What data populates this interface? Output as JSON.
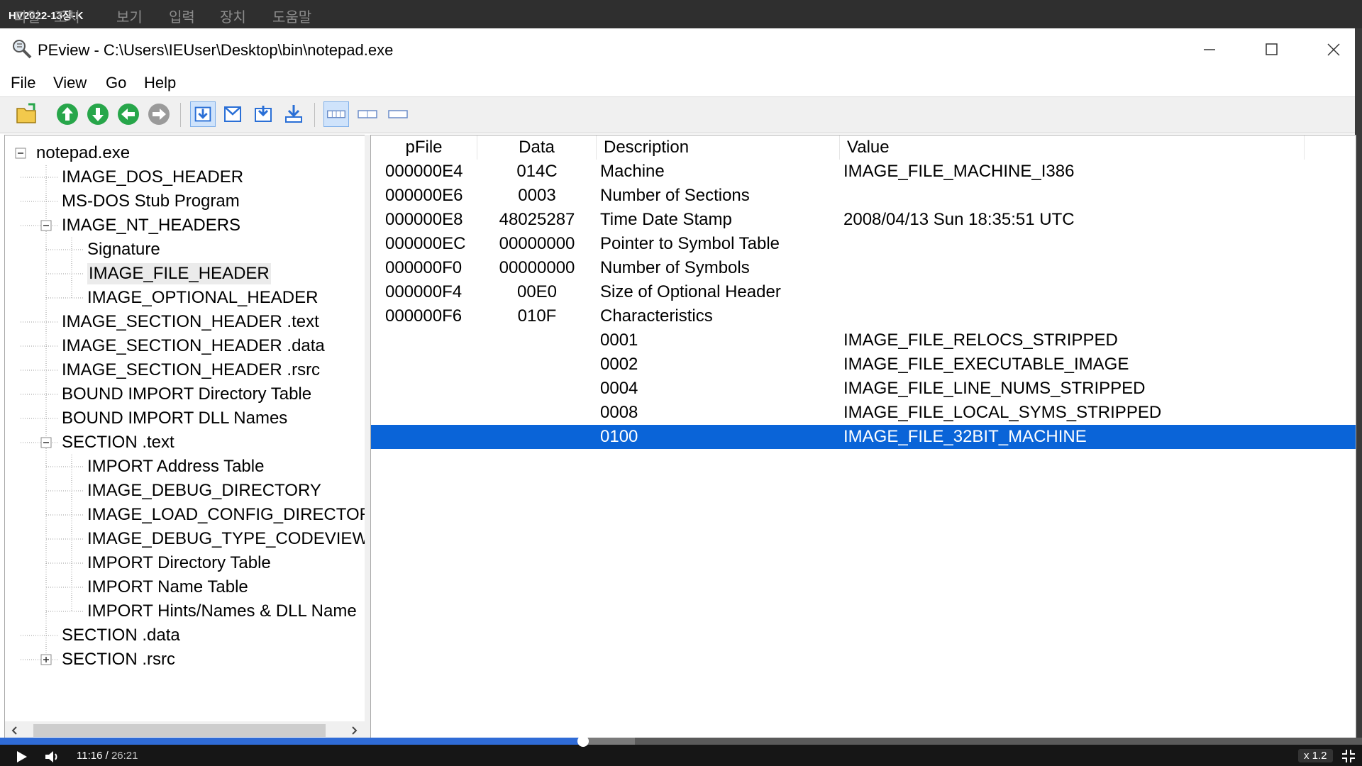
{
  "vm_window": {
    "title": "HV2022-13장-K",
    "menu": [
      "파일",
      "조치",
      "보기",
      "입력",
      "장치",
      "도움말"
    ]
  },
  "app": {
    "title": "PEview - C:\\Users\\IEUser\\Desktop\\bin\\notepad.exe",
    "icon": "magnifier-app-icon"
  },
  "window_controls": [
    "minimize-icon",
    "maximize-icon",
    "close-icon"
  ],
  "menubar": [
    "File",
    "View",
    "Go",
    "Help"
  ],
  "toolbar_icons": [
    "open-file-icon",
    "up-arrow-icon",
    "down-arrow-icon",
    "back-arrow-icon",
    "forward-arrow-icon",
    "view-byte-icon",
    "view-word-icon",
    "view-dword-icon",
    "view-address-icon",
    "view-hex-icon",
    "view-ansi-icon",
    "view-unicode-icon"
  ],
  "tree": {
    "items": [
      {
        "label": "notepad.exe",
        "level": 0,
        "expander": "minus"
      },
      {
        "label": "IMAGE_DOS_HEADER",
        "level": 1
      },
      {
        "label": "MS-DOS Stub Program",
        "level": 1
      },
      {
        "label": "IMAGE_NT_HEADERS",
        "level": 1,
        "expander": "minus"
      },
      {
        "label": "Signature",
        "level": 2
      },
      {
        "label": "IMAGE_FILE_HEADER",
        "level": 2,
        "selected": true
      },
      {
        "label": "IMAGE_OPTIONAL_HEADER",
        "level": 2
      },
      {
        "label": "IMAGE_SECTION_HEADER .text",
        "level": 1
      },
      {
        "label": "IMAGE_SECTION_HEADER .data",
        "level": 1
      },
      {
        "label": "IMAGE_SECTION_HEADER .rsrc",
        "level": 1
      },
      {
        "label": "BOUND IMPORT Directory Table",
        "level": 1
      },
      {
        "label": "BOUND IMPORT DLL Names",
        "level": 1
      },
      {
        "label": "SECTION .text",
        "level": 1,
        "expander": "minus"
      },
      {
        "label": "IMPORT Address Table",
        "level": 2
      },
      {
        "label": "IMAGE_DEBUG_DIRECTORY",
        "level": 2
      },
      {
        "label": "IMAGE_LOAD_CONFIG_DIRECTOR",
        "level": 2
      },
      {
        "label": "IMAGE_DEBUG_TYPE_CODEVIEW",
        "level": 2
      },
      {
        "label": "IMPORT Directory Table",
        "level": 2
      },
      {
        "label": "IMPORT Name Table",
        "level": 2
      },
      {
        "label": "IMPORT Hints/Names & DLL Name",
        "level": 2
      },
      {
        "label": "SECTION .data",
        "level": 1
      },
      {
        "label": "SECTION .rsrc",
        "level": 1,
        "expander": "plus"
      }
    ]
  },
  "table": {
    "columns": [
      "pFile",
      "Data",
      "Description",
      "Value"
    ],
    "rows": [
      {
        "pfile": "000000E4",
        "data": "014C",
        "description": "Machine",
        "value": "IMAGE_FILE_MACHINE_I386"
      },
      {
        "pfile": "000000E6",
        "data": "0003",
        "description": "Number of Sections",
        "value": ""
      },
      {
        "pfile": "000000E8",
        "data": "48025287",
        "description": "Time Date Stamp",
        "value": "2008/04/13 Sun 18:35:51 UTC"
      },
      {
        "pfile": "000000EC",
        "data": "00000000",
        "description": "Pointer to Symbol Table",
        "value": ""
      },
      {
        "pfile": "000000F0",
        "data": "00000000",
        "description": "Number of Symbols",
        "value": ""
      },
      {
        "pfile": "000000F4",
        "data": "00E0",
        "description": "Size of Optional Header",
        "value": ""
      },
      {
        "pfile": "000000F6",
        "data": "010F",
        "description": "Characteristics",
        "value": ""
      },
      {
        "pfile": "",
        "data": "",
        "description": "0001",
        "value": "IMAGE_FILE_RELOCS_STRIPPED"
      },
      {
        "pfile": "",
        "data": "",
        "description": "0002",
        "value": "IMAGE_FILE_EXECUTABLE_IMAGE"
      },
      {
        "pfile": "",
        "data": "",
        "description": "0004",
        "value": "IMAGE_FILE_LINE_NUMS_STRIPPED"
      },
      {
        "pfile": "",
        "data": "",
        "description": "0008",
        "value": "IMAGE_FILE_LOCAL_SYMS_STRIPPED"
      },
      {
        "pfile": "",
        "data": "",
        "description": "0100",
        "value": "IMAGE_FILE_32BIT_MACHINE",
        "selected": true
      }
    ]
  },
  "player": {
    "current_time": "11:16",
    "total_time": "26:21",
    "speed": "x 1.2",
    "progress": 0.428,
    "buffered": 0.466
  },
  "colors": {
    "selection": "#0a64d8",
    "progress": "#2f6bd6",
    "toolbar_green": "#27a64a",
    "toolbar_blue": "#2a6fd6"
  }
}
